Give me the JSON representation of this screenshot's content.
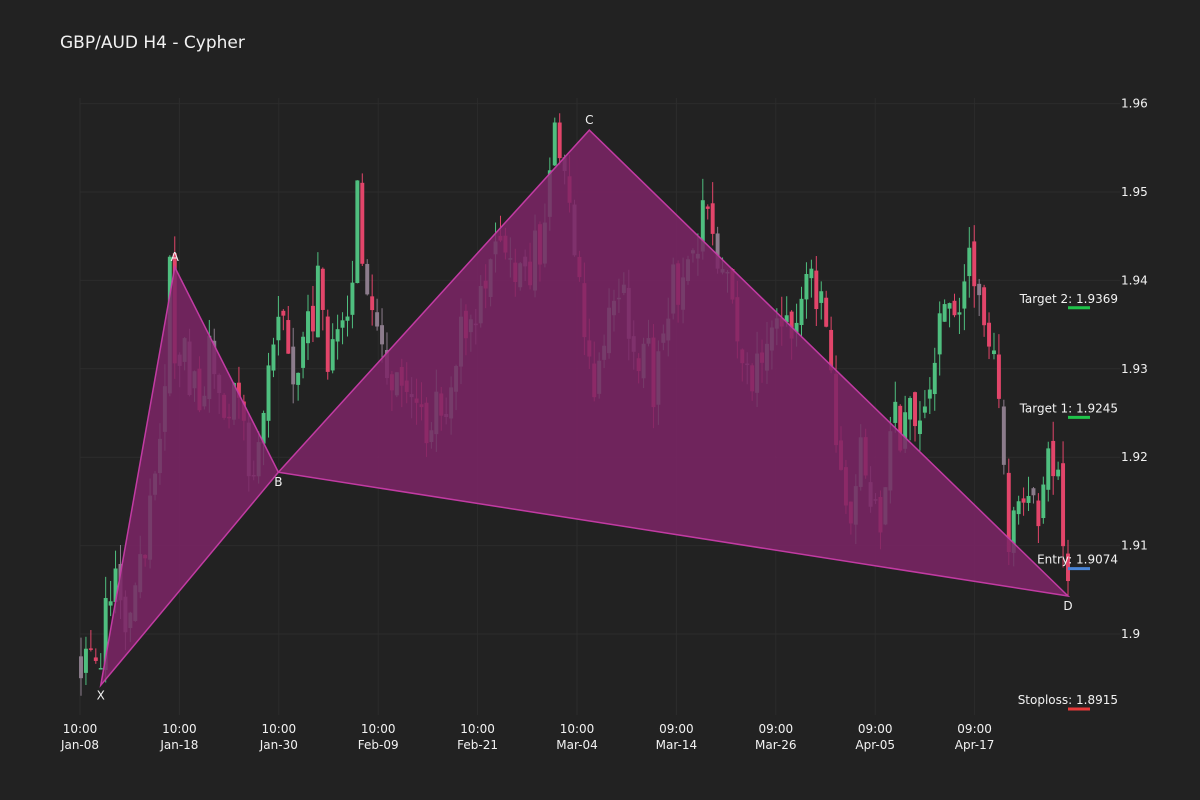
{
  "chart_data": {
    "type": "candlestick",
    "title": "GBP/AUD H4 - Cypher",
    "grid": true,
    "ylim": [
      1.8915,
      1.961
    ],
    "y_ticks": [
      {
        "value": 1.9,
        "label": "1.9"
      },
      {
        "value": 1.91,
        "label": "1.91"
      },
      {
        "value": 1.92,
        "label": "1.92"
      },
      {
        "value": 1.93,
        "label": "1.93"
      },
      {
        "value": 1.94,
        "label": "1.94"
      },
      {
        "value": 1.95,
        "label": "1.95"
      },
      {
        "value": 1.96,
        "label": "1.96"
      }
    ],
    "x_ticks": [
      {
        "date": "2024-01-08",
        "time": "10:00",
        "label": "Jan-08"
      },
      {
        "date": "2024-01-18",
        "time": "10:00",
        "label": "Jan-18"
      },
      {
        "date": "2024-01-30",
        "time": "10:00",
        "label": "Jan-30"
      },
      {
        "date": "2024-02-09",
        "time": "10:00",
        "label": "Feb-09"
      },
      {
        "date": "2024-02-21",
        "time": "10:00",
        "label": "Feb-21"
      },
      {
        "date": "2024-03-04",
        "time": "10:00",
        "label": "Mar-04"
      },
      {
        "date": "2024-03-14",
        "time": "09:00",
        "label": "Mar-14"
      },
      {
        "date": "2024-03-26",
        "time": "09:00",
        "label": "Mar-26"
      },
      {
        "date": "2024-04-05",
        "time": "09:00",
        "label": "Apr-05"
      },
      {
        "date": "2024-04-17",
        "time": "09:00",
        "label": "Apr-17"
      }
    ],
    "price_path": [
      [
        0,
        1.898
      ],
      [
        2,
        1.896
      ],
      [
        3,
        1.8945
      ],
      [
        6,
        1.906
      ],
      [
        9,
        1.902
      ],
      [
        13,
        1.91
      ],
      [
        16,
        1.922
      ],
      [
        18,
        1.94
      ],
      [
        19,
        1.932
      ],
      [
        22,
        1.93
      ],
      [
        24,
        1.924
      ],
      [
        26,
        1.933
      ],
      [
        28,
        1.93
      ],
      [
        30,
        1.924
      ],
      [
        32,
        1.927
      ],
      [
        34,
        1.92
      ],
      [
        36,
        1.921
      ],
      [
        38,
        1.932
      ],
      [
        40,
        1.937
      ],
      [
        42,
        1.932
      ],
      [
        44,
        1.928
      ],
      [
        46,
        1.934
      ],
      [
        48,
        1.94
      ],
      [
        50,
        1.932
      ],
      [
        52,
        1.936
      ],
      [
        54,
        1.933
      ],
      [
        56,
        1.95
      ],
      [
        58,
        1.938
      ],
      [
        62,
        1.93
      ],
      [
        66,
        1.926
      ],
      [
        70,
        1.922
      ],
      [
        74,
        1.927
      ],
      [
        78,
        1.935
      ],
      [
        82,
        1.94
      ],
      [
        86,
        1.944
      ],
      [
        90,
        1.94
      ],
      [
        94,
        1.946
      ],
      [
        96,
        1.955
      ],
      [
        98,
        1.952
      ],
      [
        100,
        1.945
      ],
      [
        102,
        1.935
      ],
      [
        104,
        1.928
      ],
      [
        106,
        1.935
      ],
      [
        108,
        1.94
      ],
      [
        110,
        1.937
      ],
      [
        112,
        1.93
      ],
      [
        114,
        1.934
      ],
      [
        116,
        1.928
      ],
      [
        118,
        1.935
      ],
      [
        120,
        1.94
      ],
      [
        122,
        1.938
      ],
      [
        124,
        1.942
      ],
      [
        126,
        1.948
      ],
      [
        128,
        1.946
      ],
      [
        130,
        1.942
      ],
      [
        132,
        1.935
      ],
      [
        134,
        1.93
      ],
      [
        136,
        1.928
      ],
      [
        138,
        1.93
      ],
      [
        140,
        1.932
      ],
      [
        142,
        1.936
      ],
      [
        144,
        1.932
      ],
      [
        146,
        1.936
      ],
      [
        148,
        1.942
      ],
      [
        150,
        1.936
      ],
      [
        152,
        1.928
      ],
      [
        154,
        1.918
      ],
      [
        156,
        1.913
      ],
      [
        158,
        1.92
      ],
      [
        160,
        1.912
      ],
      [
        162,
        1.914
      ],
      [
        164,
        1.925
      ],
      [
        166,
        1.922
      ],
      [
        168,
        1.926
      ],
      [
        170,
        1.922
      ],
      [
        172,
        1.928
      ],
      [
        174,
        1.935
      ],
      [
        176,
        1.94
      ],
      [
        178,
        1.935
      ],
      [
        180,
        1.943
      ],
      [
        182,
        1.94
      ],
      [
        184,
        1.935
      ],
      [
        186,
        1.924
      ],
      [
        188,
        1.912
      ],
      [
        190,
        1.915
      ],
      [
        192,
        1.918
      ],
      [
        194,
        1.913
      ],
      [
        196,
        1.921
      ],
      [
        198,
        1.916
      ],
      [
        199,
        1.912
      ],
      [
        200,
        1.9065
      ]
    ],
    "pattern": {
      "fill": "#7d2566",
      "stroke": "#c23ba3",
      "points": [
        {
          "name": "X",
          "label": "X",
          "i": 4,
          "price": 1.8942
        },
        {
          "name": "A",
          "label": "A",
          "i": 19,
          "price": 1.9415
        },
        {
          "name": "B",
          "label": "B",
          "i": 40,
          "price": 1.9183
        },
        {
          "name": "C",
          "label": "C",
          "i": 103,
          "price": 1.957
        },
        {
          "name": "D",
          "label": "D",
          "i": 200,
          "price": 1.9043
        }
      ]
    },
    "levels": [
      {
        "name": "target-2",
        "label": "Target 2: 1.9369",
        "price": 1.9369,
        "color": "#1fc44a"
      },
      {
        "name": "target-1",
        "label": "Target 1: 1.9245",
        "price": 1.9245,
        "color": "#1fc44a"
      },
      {
        "name": "entry",
        "label": "Entry: 1.9074",
        "price": 1.9074,
        "color": "#4a86d8"
      },
      {
        "name": "stoploss",
        "label": "Stoploss: 1.8915",
        "price": 1.8915,
        "color": "#e83a3a"
      }
    ],
    "candle_colors": {
      "up": "#4fbf7f",
      "down": "#e2456a",
      "neutral": "#8c7c8c"
    },
    "grid_color": "#2c2c2c",
    "bar_count": 201
  }
}
